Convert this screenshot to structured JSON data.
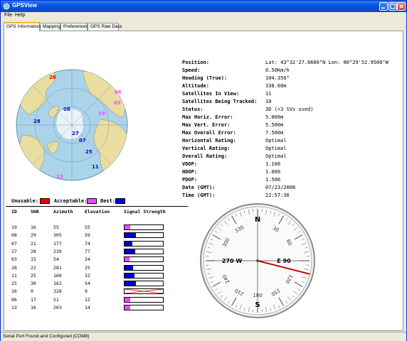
{
  "window": {
    "title": "GPSView"
  },
  "menu": {
    "file": "File",
    "help": "Help"
  },
  "tabs": [
    {
      "label": "GPS Information",
      "active": true
    },
    {
      "label": "Mapping",
      "active": false
    },
    {
      "label": "Preferences",
      "active": false
    },
    {
      "label": "GPS Raw Data",
      "active": false
    }
  ],
  "info": [
    {
      "label": "Position:",
      "value": "Lat: 43°32'27.0600\"N Lon: 80°29'52.9500\"W"
    },
    {
      "label": "Speed:",
      "value": "0.50Km/h"
    },
    {
      "label": "Heading (True):",
      "value": "104.350°"
    },
    {
      "label": "Altitude:",
      "value": "338.60m"
    },
    {
      "label": "Satellites In View:",
      "value": "11"
    },
    {
      "label": "Satellites Being Tracked:",
      "value": "10"
    },
    {
      "label": "Status:",
      "value": "3D (>3 SVs used)"
    },
    {
      "label": "Max Horiz. Error:",
      "value": "5.000m"
    },
    {
      "label": "Max Vert. Error:",
      "value": "5.500m"
    },
    {
      "label": "Max Overall Error:",
      "value": "7.500m"
    },
    {
      "label": "Horizontal Rating:",
      "value": "Optimal"
    },
    {
      "label": "Vertical Rating:",
      "value": "Optimal"
    },
    {
      "label": "Overall Rating:",
      "value": "Optimal"
    },
    {
      "label": "VDOP:",
      "value": "1.100"
    },
    {
      "label": "HDOP:",
      "value": "1.000"
    },
    {
      "label": "PDOP:",
      "value": "1.500"
    },
    {
      "label": "Date (GMT):",
      "value": "07/23/2008"
    },
    {
      "label": "Time (GMT):",
      "value": "22:57:36"
    }
  ],
  "legend": {
    "unusable": "Unusable:",
    "acceptable": "Acceptable:",
    "best": "Best:"
  },
  "colors": {
    "unusable": "#e00000",
    "acceptable": "#ff44ff",
    "best": "#0000cc",
    "needle": "#cc0000"
  },
  "satellite_table": {
    "headers": [
      "ID",
      "SNR",
      "Azimuth",
      "Elevation",
      "Signal Strength"
    ],
    "rows": [
      {
        "id": "19",
        "snr": "16",
        "azimuth": "55",
        "elevation": "55",
        "signal": 16,
        "quality": "acceptable"
      },
      {
        "id": "08",
        "snr": "29",
        "azimuth": "305",
        "elevation": "59",
        "signal": 29,
        "quality": "best"
      },
      {
        "id": "07",
        "snr": "21",
        "azimuth": "177",
        "elevation": "74",
        "signal": 21,
        "quality": "best"
      },
      {
        "id": "27",
        "snr": "28",
        "azimuth": "230",
        "elevation": "77",
        "signal": 28,
        "quality": "best"
      },
      {
        "id": "03",
        "snr": "15",
        "azimuth": "54",
        "elevation": "24",
        "signal": 15,
        "quality": "acceptable"
      },
      {
        "id": "28",
        "snr": "22",
        "azimuth": "281",
        "elevation": "25",
        "signal": 22,
        "quality": "best"
      },
      {
        "id": "11",
        "snr": "25",
        "azimuth": "160",
        "elevation": "32",
        "signal": 25,
        "quality": "best"
      },
      {
        "id": "25",
        "snr": "30",
        "azimuth": "162",
        "elevation": "54",
        "signal": 30,
        "quality": "best"
      },
      {
        "id": "26",
        "snr": "0",
        "azimuth": "328",
        "elevation": "9",
        "signal": 0,
        "quality": "unusable"
      },
      {
        "id": "06",
        "snr": "17",
        "azimuth": "51",
        "elevation": "12",
        "signal": 17,
        "quality": "acceptable"
      },
      {
        "id": "13",
        "snr": "16",
        "azimuth": "203",
        "elevation": "14",
        "signal": 16,
        "quality": "acceptable"
      }
    ]
  },
  "skyplot_labels": [
    {
      "id": "26",
      "color": "#e00000"
    },
    {
      "id": "06",
      "color": "#ff44ff"
    },
    {
      "id": "03",
      "color": "#ff44ff"
    },
    {
      "id": "08",
      "color": "#0000cc"
    },
    {
      "id": "19",
      "color": "#ff44ff"
    },
    {
      "id": "28",
      "color": "#0000cc"
    },
    {
      "id": "27",
      "color": "#0000cc"
    },
    {
      "id": "07",
      "color": "#0000cc"
    },
    {
      "id": "25",
      "color": "#0000cc"
    },
    {
      "id": "11",
      "color": "#0000cc"
    },
    {
      "id": "13",
      "color": "#ff44ff"
    }
  ],
  "compass": {
    "heading": 104.35,
    "cardinals": {
      "n": "N",
      "e": "E 90",
      "s": "S",
      "w": "270 W"
    },
    "ticks": [
      "30",
      "60",
      "120",
      "150",
      "180",
      "210",
      "240",
      "300",
      "330"
    ]
  },
  "status": {
    "text": "Serial Port Found and Configured [COM8]"
  }
}
